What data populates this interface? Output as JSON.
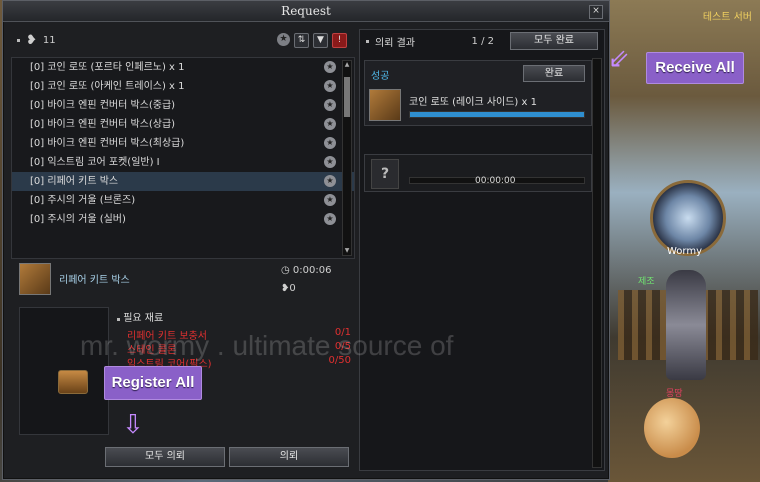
{
  "window": {
    "title": "Request",
    "close_symbol": "×"
  },
  "left": {
    "count": "11",
    "items": [
      "[0] 코인 로또 (포르타 인페르노) x 1",
      "[0] 코인 로또 (아케인 트레이스) x 1",
      "[0] 바이크 엔핀 컨버터 박스(중급)",
      "[0] 바이크 엔핀 컨버터 박스(상급)",
      "[0] 바이크 엔핀 컨버터 박스(최상급)",
      "[0] 익스트림 코어 포켓(일반) I",
      "[0] 리페어 키트 박스",
      "[0] 주시의 거울 (브론즈)",
      "[0] 주시의 거울 (실버)"
    ],
    "selected_index": 6,
    "detail": {
      "name": "리페어 키트 박스",
      "time": "0:00:06",
      "hearts": "0"
    },
    "materials_title": "필요 재료",
    "materials": [
      {
        "name": "리페어 키트 보충서",
        "qty": "0/1"
      },
      {
        "name": "스테인 콜론",
        "qty": "0/5"
      },
      {
        "name": "익스트림 코어(픽스)",
        "qty": "0/50"
      }
    ],
    "buttons": {
      "register_all": "모두 의뢰",
      "register": "의뢰"
    }
  },
  "right": {
    "title": "의뢰 결과",
    "page": "1 / 2",
    "all_done": "모두 완료",
    "result": {
      "status": "성공",
      "done_label": "완료",
      "item_name": "코인 로또 (레이크 사이드) x 1",
      "progress": 1.0
    },
    "pending": {
      "time": "00:00:00",
      "question": "?"
    }
  },
  "callouts": {
    "receive_all": "Receive All",
    "register_all": "Register All"
  },
  "scene": {
    "server": "테스트 서버",
    "player": "Wormy",
    "green_name": "제조",
    "red_name": "몽땅"
  },
  "watermark": "mr. wormy . ultimate source of",
  "colors": {
    "accent": "#8a60c8",
    "progress": "#2f8fd0",
    "missing": "#e03030",
    "success": "#4fb8e8"
  }
}
